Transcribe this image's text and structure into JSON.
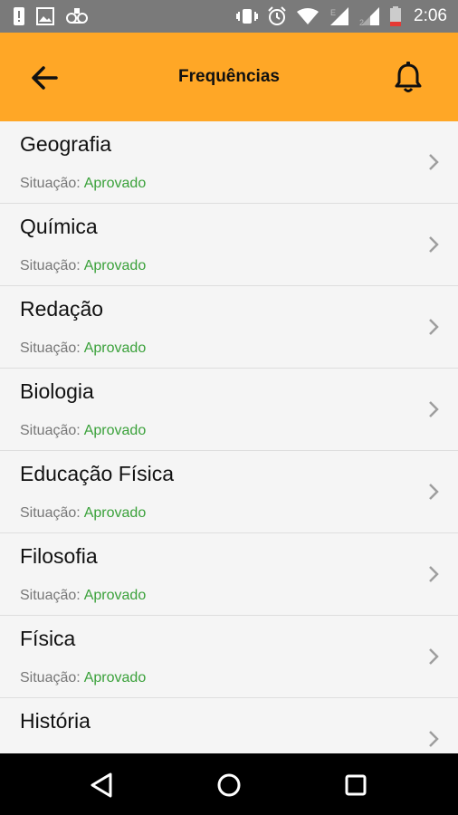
{
  "status_bar": {
    "time": "2:06",
    "icons": [
      "alert-icon",
      "image-icon",
      "voicemail-icon",
      "vibrate-icon",
      "alarm-icon",
      "wifi-icon",
      "signal-e-icon",
      "signal-2-icon",
      "battery-icon"
    ]
  },
  "app_bar": {
    "title": "Frequências",
    "accent_color": "#ffa726"
  },
  "list": {
    "status_label": "Situação:",
    "status_color": "#3aa13a",
    "items": [
      {
        "title": "Geografia",
        "status": "Aprovado"
      },
      {
        "title": "Química",
        "status": "Aprovado"
      },
      {
        "title": "Redação",
        "status": "Aprovado"
      },
      {
        "title": "Biologia",
        "status": "Aprovado"
      },
      {
        "title": "Educação Física",
        "status": "Aprovado"
      },
      {
        "title": "Filosofia",
        "status": "Aprovado"
      },
      {
        "title": "Física",
        "status": "Aprovado"
      },
      {
        "title": "História",
        "status": ""
      }
    ]
  },
  "nav_bar": {
    "icons": [
      "back-triangle-icon",
      "home-circle-icon",
      "recents-square-icon"
    ]
  }
}
